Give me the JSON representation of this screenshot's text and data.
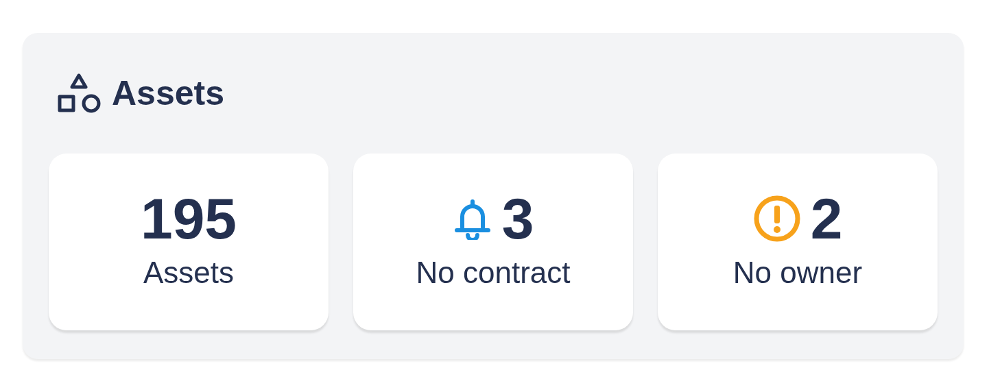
{
  "panel": {
    "title": "Assets"
  },
  "stats": [
    {
      "kind": "plain",
      "value": "195",
      "label": "Assets"
    },
    {
      "kind": "notice",
      "value": "3",
      "label": "No contract"
    },
    {
      "kind": "warning",
      "value": "2",
      "label": "No owner"
    }
  ]
}
